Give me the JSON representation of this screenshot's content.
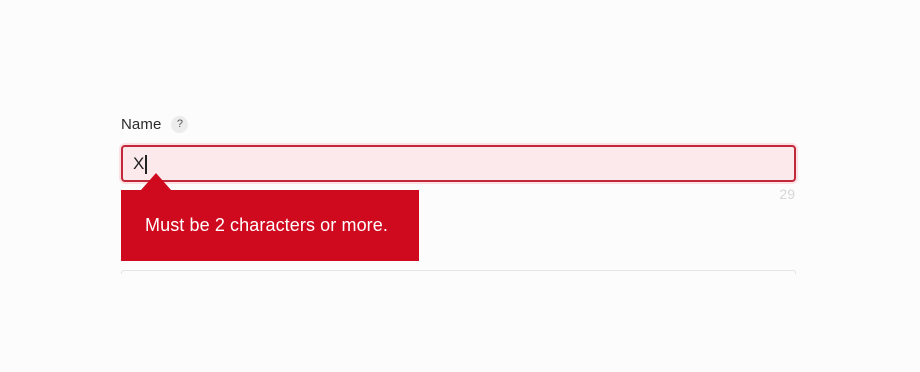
{
  "form": {
    "name_field": {
      "label": "Name",
      "help_glyph": "?",
      "help_icon": "question-mark-icon",
      "value": "X",
      "character_counter": "29",
      "state": "error"
    },
    "validation": {
      "message": "Must be 2 characters or more."
    }
  },
  "colors": {
    "error_red": "#d00a1e",
    "input_error_border": "#c1283a",
    "input_error_bg": "#fbe9eb"
  }
}
